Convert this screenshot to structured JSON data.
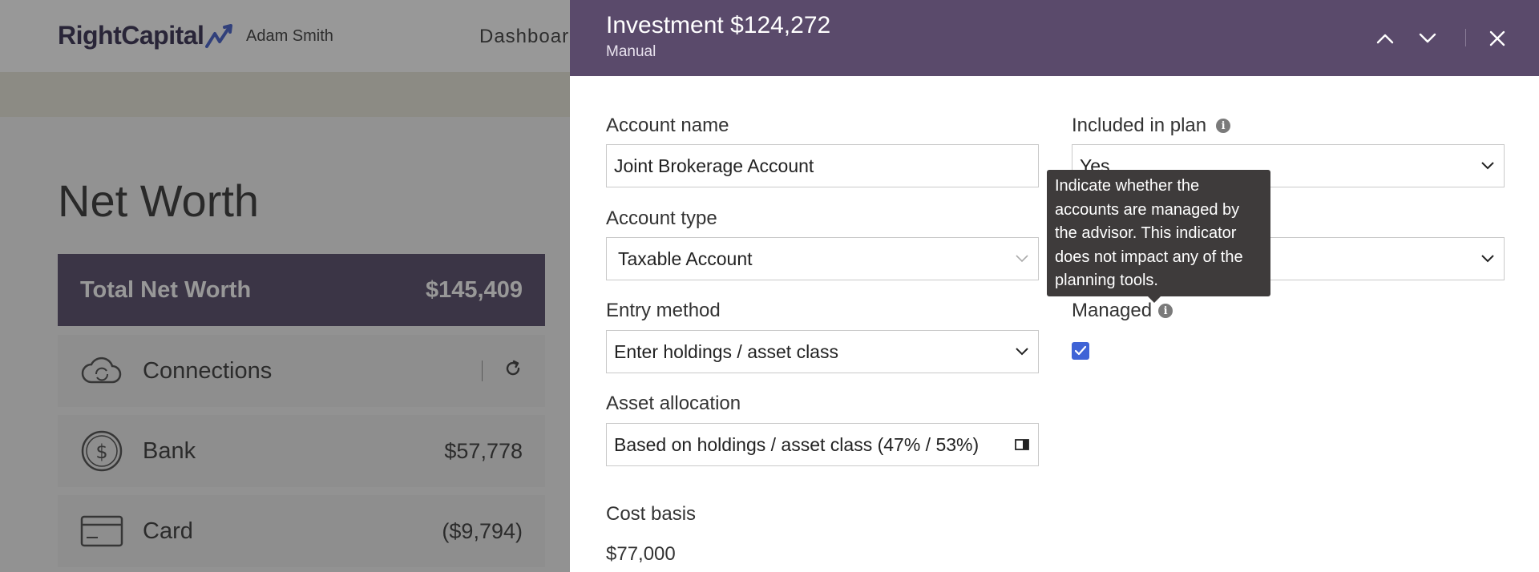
{
  "app": {
    "brand": "RightCapital",
    "user_name": "Adam Smith",
    "nav_dashboard": "Dashboard"
  },
  "page": {
    "title": "Net Worth",
    "total_label": "Total Net Worth",
    "total_value": "$145,409",
    "rows": [
      {
        "label": "Connections",
        "amount": "",
        "icon": "cloud-sync-icon"
      },
      {
        "label": "Bank",
        "amount": "$57,778",
        "icon": "dollar-coin-icon"
      },
      {
        "label": "Card",
        "amount": "($9,794)",
        "icon": "credit-card-icon"
      }
    ]
  },
  "drawer": {
    "title": "Investment $124,272",
    "subtitle": "Manual",
    "fields": {
      "account_name_label": "Account name",
      "account_name_value": "Joint Brokerage Account",
      "account_type_label": "Account type",
      "account_type_value": "Taxable Account",
      "entry_method_label": "Entry method",
      "entry_method_value": "Enter holdings / asset class",
      "asset_allocation_label": "Asset allocation",
      "asset_allocation_value": "Based on holdings / asset class (47% / 53%)",
      "included_label": "Included in plan",
      "included_value": "Yes",
      "owner_value": "",
      "managed_label": "Managed",
      "managed_checked": true,
      "cost_basis_label": "Cost basis",
      "cost_basis_value": "$77,000"
    },
    "tooltip": "Indicate whether the accounts are managed by the advisor. This indicator does not impact any of the planning tools."
  },
  "colors": {
    "header_purple": "#5a4a6b",
    "networth_purple": "#4e4262",
    "checkbox_blue": "#3f63d6",
    "tooltip_bg": "#3e3b3b"
  }
}
